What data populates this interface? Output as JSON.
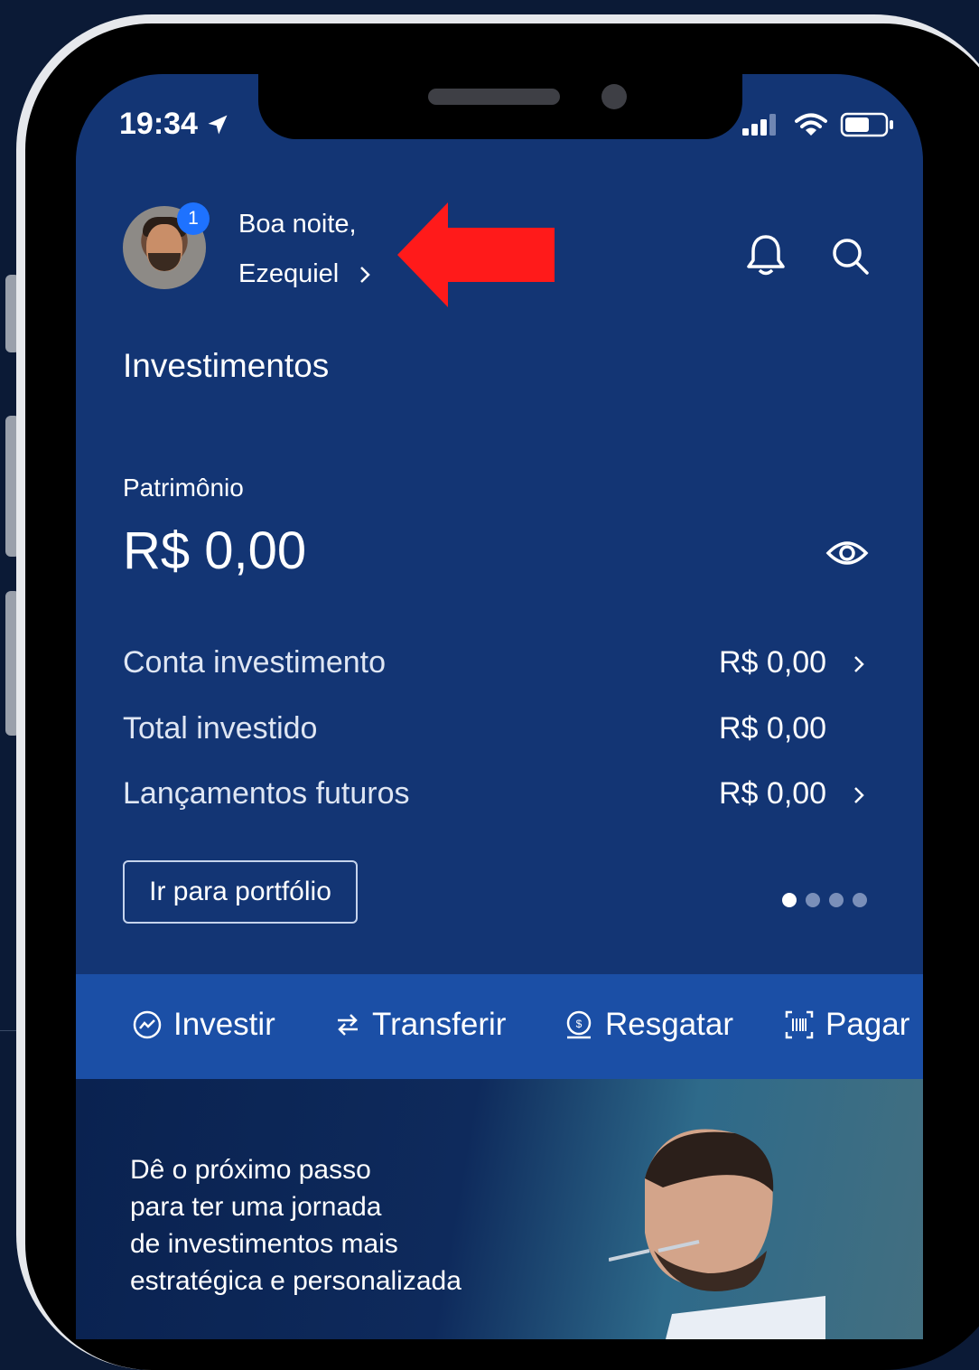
{
  "status_bar": {
    "time": "19:34"
  },
  "header": {
    "notification_count": "1",
    "greeting_line1": "Boa noite,",
    "greeting_name": "Ezequiel"
  },
  "section_title": "Investimentos",
  "patrimonio": {
    "label": "Patrimônio",
    "value": "R$ 0,00"
  },
  "summary_rows": [
    {
      "label": "Conta investimento",
      "value": "R$ 0,00"
    },
    {
      "label": "Total investido",
      "value": "R$ 0,00"
    },
    {
      "label": "Lançamentos futuros",
      "value": "R$ 0,00"
    }
  ],
  "portfolio_button": "Ir para portfólio",
  "pagination": {
    "total": 4,
    "active_index": 0
  },
  "actions": [
    {
      "label": "Investir",
      "icon": "invest-icon"
    },
    {
      "label": "Transferir",
      "icon": "transfer-icon"
    },
    {
      "label": "Resgatar",
      "icon": "redeem-icon"
    },
    {
      "label": "Pagar",
      "icon": "barcode-icon"
    }
  ],
  "promo": {
    "lines": [
      "Dê o próximo passo",
      "para ter uma jornada",
      "de investimentos mais",
      "estratégica e personalizada"
    ]
  },
  "colors": {
    "screen_bg": "#133574",
    "action_bar": "#1b4fa6",
    "badge": "#1e72ff",
    "arrow": "#ff1a1a"
  }
}
